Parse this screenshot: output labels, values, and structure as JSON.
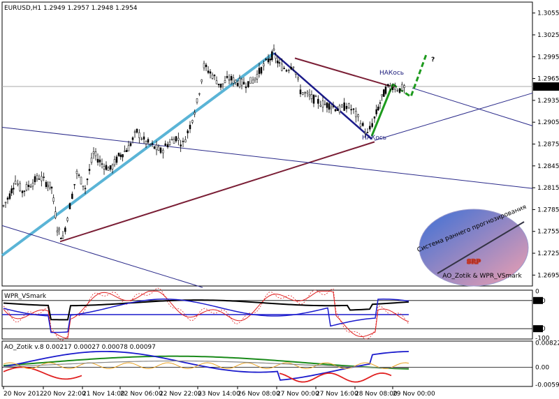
{
  "chart_data": {
    "type": "candlestick",
    "main": {
      "title": "EURUSD,H1  1.2949 1.2957 1.2948 1.2954",
      "price_ticks": [
        "1.3055",
        "1.3025",
        "1.2995",
        "1.2965",
        "1.2935",
        "1.2905",
        "1.2875",
        "1.2845",
        "1.2815",
        "1.2785",
        "1.2755",
        "1.2725",
        "1.2695"
      ],
      "price_values": [
        1.3055,
        1.3025,
        1.2995,
        1.2965,
        1.2935,
        1.2905,
        1.2875,
        1.2845,
        1.2815,
        1.2785,
        1.2755,
        1.2725,
        1.2695
      ],
      "ylim": [
        1.268,
        1.307
      ],
      "current_price": "1.2954",
      "current_value": 1.2954,
      "annotations": [
        "НАКось",
        "НАКось",
        "?"
      ],
      "colors": {
        "uptrend": "#5ab4d6",
        "downtrend": "#1b1b8a",
        "channel": "#7a1e35",
        "thin": "#2a2a8a",
        "forecast": "#1d9a1d",
        "question": "#cc3344"
      }
    },
    "wpr": {
      "title": "WPR_VSmark",
      "ticks": [
        "0",
        "-20",
        "-80",
        "-100"
      ],
      "tick_values": [
        0,
        -20,
        -80,
        -100
      ],
      "ylim": [
        -102,
        2
      ]
    },
    "ao": {
      "title": "AO_Zotik v.8 0.00217 0.00027 0.00078 0.00097",
      "ticks": [
        "0.00822",
        "0.00",
        "-0.00597"
      ],
      "tick_values": [
        0.00822,
        0.0,
        -0.00597
      ],
      "ylim": [
        -0.0065,
        0.0088
      ]
    },
    "x_labels": [
      "20 Nov 2012",
      "20 Nov 22:00",
      "21 Nov 14:00",
      "22 Nov 06:00",
      "22 Nov 22:00",
      "23 Nov 14:00",
      "26 Nov 08:00",
      "27 Nov 00:00",
      "27 Nov 16:00",
      "28 Nov 08:00",
      "29 Nov 00:00"
    ],
    "watermark": {
      "text": "SRP",
      "top_text": "Система раннего прогнозирования",
      "bottom_text": "AO_Zotik & WPR_VSmark"
    }
  }
}
